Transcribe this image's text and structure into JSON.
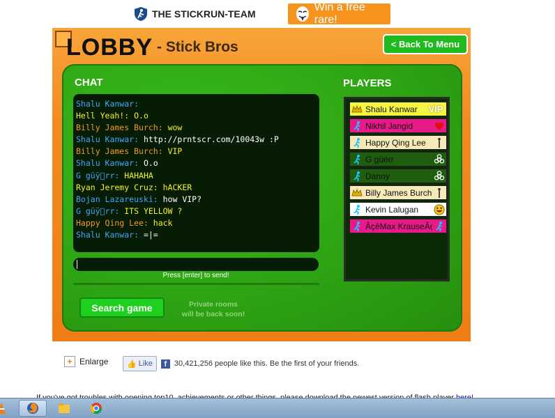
{
  "header": {
    "brand_text": "THE STICKRUN-TEAM",
    "promo_text": "Win a free rare!"
  },
  "game": {
    "title": "LOBBY",
    "subtitle": "- Stick Bros",
    "back_button": "< Back To Menu",
    "chat_title": "CHAT",
    "players_title": "PLAYERS",
    "hint": "Press [enter] to send!",
    "search_button": "Search game",
    "private_line1": "Private rooms",
    "private_line2": "will be back soon!",
    "colors": {
      "blue_name": "#3fa8ff",
      "orange_name": "#f59a1f",
      "white_text": "#ffffff",
      "yellow_text": "#f5f51f"
    },
    "chat": [
      {
        "name": "Shalu Kanwar:",
        "text": "",
        "color": "#3fa8ff",
        "text_color": "#ffffff"
      },
      {
        "name": "Hell Yeah!:",
        "text": "O.o",
        "color": "#f5f51f",
        "text_color": "#f5f51f"
      },
      {
        "name": "Billy James Burch:",
        "text": "wow",
        "color": "#f59a1f",
        "text_color": "#f5f51f"
      },
      {
        "name": "Shalu Kanwar:",
        "text": "http://prntscr.com/10043w :P",
        "color": "#3fa8ff",
        "text_color": "#ffffff"
      },
      {
        "name": "Billy James Burch:",
        "text": "VIP",
        "color": "#f59a1f",
        "text_color": "#f5f51f"
      },
      {
        "name": "Shalu Kanwar:",
        "text": "O.o",
        "color": "#3fa8ff",
        "text_color": "#ffffff"
      },
      {
        "name": "G güÿ\u0000rr:",
        "text": "HAHAHA",
        "color": "#3fa8ff",
        "text_color": "#f5f51f"
      },
      {
        "name": "Ryan Jeremy Cruz:",
        "text": "hACKER",
        "color": "#f5f51f",
        "text_color": "#f5f51f"
      },
      {
        "name": "Bojan Lazareuski:",
        "text": "how VIP?",
        "color": "#3fa8ff",
        "text_color": "#ffffff"
      },
      {
        "name": "G güÿ\u0000rr:",
        "text": "ITS YELLOW ?",
        "color": "#3fa8ff",
        "text_color": "#f5f51f"
      },
      {
        "name": "Happy Qing Lee:",
        "text": "hack",
        "color": "#f59a1f",
        "text_color": "#f5f51f"
      },
      {
        "name": "Shalu Kanwar:",
        "text": "=|=",
        "color": "#3fa8ff",
        "text_color": "#ffffff"
      }
    ],
    "players": [
      {
        "name": "Shalu Kanwar",
        "bg": "#f5f542",
        "icon": "crown-icon",
        "badge": "VIP",
        "badge_icon": "vip-icon"
      },
      {
        "name": "Nikhil Jangid",
        "bg": "#e81a8a",
        "icon": "stickman-icon",
        "badge": "",
        "badge_icon": "heart-icon"
      },
      {
        "name": "Happy Qing Lee",
        "bg": "#f5e9b8",
        "icon": "stickman-icon",
        "badge": "",
        "badge_icon": "stick-figure-icon"
      },
      {
        "name": "G güérr",
        "bg": "#1f5d0f",
        "icon": "stickman-icon",
        "badge": "",
        "badge_icon": "biohazard-icon"
      },
      {
        "name": "Danny",
        "bg": "#1f5d0f",
        "icon": "stickman-icon",
        "badge": "",
        "badge_icon": "biohazard-icon"
      },
      {
        "name": "Billy James Burch",
        "bg": "#f5e9b8",
        "icon": "crown-icon",
        "badge": "",
        "badge_icon": "stick-figure-icon"
      },
      {
        "name": "Kevin Lalugan",
        "bg": "#ffffff",
        "icon": "stickman-icon",
        "badge": "",
        "badge_icon": "smiley-icon"
      },
      {
        "name": "ÂçêMax KrauseÂçe",
        "bg": "#e81a8a",
        "icon": "stickman-icon",
        "badge": "",
        "badge_icon": "stickman-icon"
      }
    ]
  },
  "below": {
    "enlarge_label": "Enlarge",
    "like_button": "Like",
    "like_text": "30,421,256 people like this. Be the first of your friends.",
    "notice_text": "If you've got troubles with opening top10, achievements or other things, please download the newest version of flash player",
    "notice_link": "here!"
  }
}
